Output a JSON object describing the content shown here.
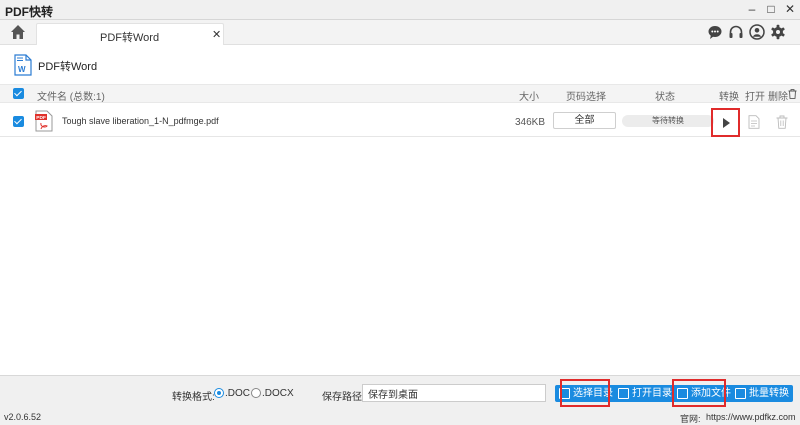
{
  "window": {
    "title": "PDF快转",
    "minimize": "–",
    "maximize": "□",
    "close": "✕"
  },
  "tabs": [
    {
      "label": "PDF转Word",
      "close": "✕"
    }
  ],
  "page": {
    "title": "PDF转Word"
  },
  "table": {
    "headers": {
      "filename": "文件名 (总数:1)",
      "size": "大小",
      "pages": "页码选择",
      "status": "状态",
      "convert": "转换",
      "open": "打开",
      "delete": "删除"
    },
    "rows": [
      {
        "name": "Tough slave liberation_1-N_pdfmge.pdf",
        "size": "346KB",
        "pages": "全部",
        "status": "等待转换",
        "selected": true
      }
    ]
  },
  "bottom": {
    "format_label": "转换格式:",
    "format_options": [
      {
        "label": ".DOC",
        "selected": true
      },
      {
        "label": ".DOCX",
        "selected": false
      }
    ],
    "path_label": "保存路径:",
    "path_value": "保存到桌面",
    "buttons": {
      "choose_dir": "选择目录",
      "open_dir": "打开目录",
      "add_file": "添加文件",
      "batch_convert": "批量转换"
    }
  },
  "footer": {
    "version": "v2.0.6.52",
    "site_label": "官网:",
    "site": "https://www.pdfkz.com"
  },
  "colors": {
    "accent": "#1a8be0",
    "highlight": "#e02b2b"
  }
}
